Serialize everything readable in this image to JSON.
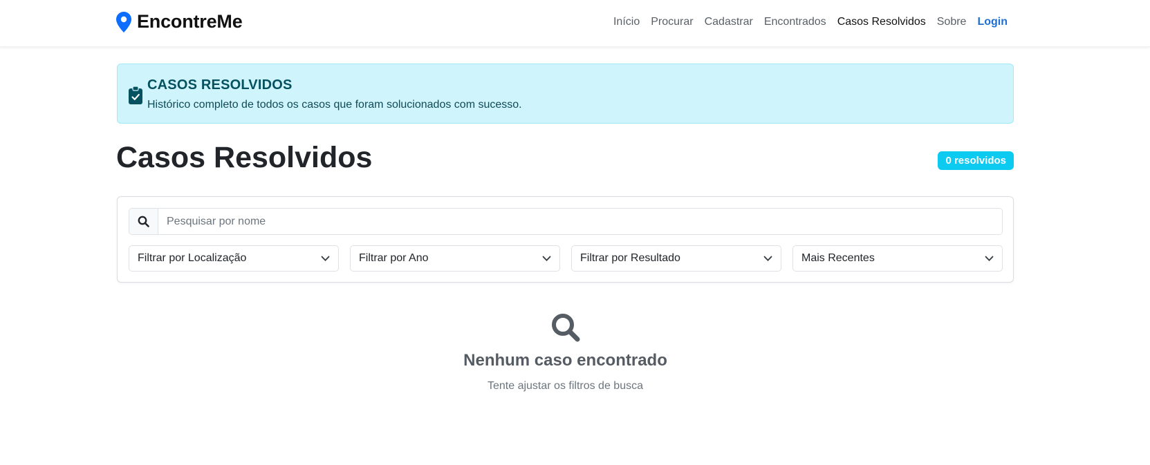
{
  "brand": {
    "name": "EncontreMe",
    "icon": "map-pin-icon",
    "icon_color": "#0d6efd"
  },
  "nav": {
    "items": [
      {
        "label": "Início"
      },
      {
        "label": "Procurar"
      },
      {
        "label": "Cadastrar"
      },
      {
        "label": "Encontrados"
      },
      {
        "label": "Casos Resolvidos",
        "active": true
      },
      {
        "label": "Sobre"
      }
    ],
    "login": "Login"
  },
  "alert": {
    "icon": "clipboard-check-icon",
    "title": "CASOS RESOLVIDOS",
    "subtitle": "Histórico completo de todos os casos que foram solucionados com sucesso.",
    "background": "#cff4fc",
    "text_color": "#055160"
  },
  "page": {
    "title": "Casos Resolvidos",
    "badge": "0 resolvidos",
    "badge_color": "#0dcaf0"
  },
  "filters": {
    "search_placeholder": "Pesquisar por nome",
    "search_value": "",
    "selects": [
      {
        "value": "Filtrar por Localização"
      },
      {
        "value": "Filtrar por Ano"
      },
      {
        "value": "Filtrar por Resultado"
      },
      {
        "value": "Mais Recentes"
      }
    ]
  },
  "empty_state": {
    "icon": "search-icon",
    "title": "Nenhum caso encontrado",
    "subtitle": "Tente ajustar os filtros de busca"
  }
}
